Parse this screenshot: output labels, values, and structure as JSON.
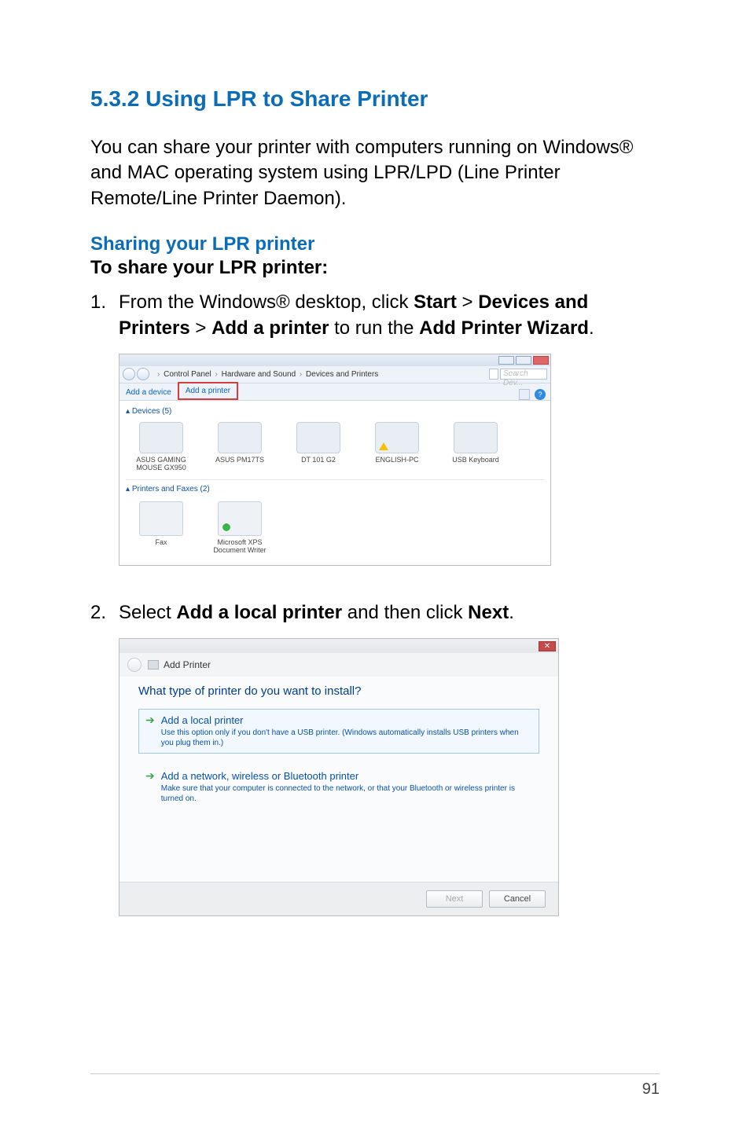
{
  "page_number": "91",
  "section": {
    "number": "5.3.2",
    "title": "Using LPR to Share Printer"
  },
  "intro": "You can share your printer with computers running on Windows® and MAC operating system using LPR/LPD (Line Printer Remote/Line Printer Daemon).",
  "sharing_heading": "Sharing your LPR printer",
  "to_share": "To share your LPR printer:",
  "steps": {
    "1": {
      "num": "1.",
      "prefix": "From the Windows® desktop, click ",
      "b1": "Start",
      "gt1": " > ",
      "b2": "Devices and Printers",
      "gt2": " > ",
      "b3": "Add a printer",
      "mid": " to run the ",
      "b4": "Add Printer Wizard",
      "suffix": "."
    },
    "2": {
      "num": "2.",
      "prefix": "Select ",
      "b1": "Add a local printer",
      "mid": " and then click ",
      "b2": "Next",
      "suffix": "."
    }
  },
  "shot1": {
    "breadcrumb": {
      "a": "Control Panel",
      "b": "Hardware and Sound",
      "c": "Devices and Printers",
      "sep": "›"
    },
    "search_placeholder": "Search Dev...",
    "toolbar": {
      "add_device": "Add a device",
      "add_printer": "Add a printer"
    },
    "group_devices": "Devices (5)",
    "devices": [
      {
        "label": "ASUS GAMING MOUSE GX950"
      },
      {
        "label": "ASUS PM17TS"
      },
      {
        "label": "DT 101 G2"
      },
      {
        "label": "ENGLISH-PC"
      },
      {
        "label": "USB Keyboard"
      }
    ],
    "group_printers": "Printers and Faxes (2)",
    "printers": [
      {
        "label": "Fax"
      },
      {
        "label": "Microsoft XPS Document Writer"
      }
    ]
  },
  "shot2": {
    "title": "Add Printer",
    "question": "What type of printer do you want to install?",
    "options": [
      {
        "title": "Add a local printer",
        "desc": "Use this option only if you don't have a USB printer. (Windows automatically installs USB printers when you plug them in.)"
      },
      {
        "title": "Add a network, wireless or Bluetooth printer",
        "desc": "Make sure that your computer is connected to the network, or that your Bluetooth or wireless printer is turned on."
      }
    ],
    "buttons": {
      "next": "Next",
      "cancel": "Cancel"
    }
  }
}
